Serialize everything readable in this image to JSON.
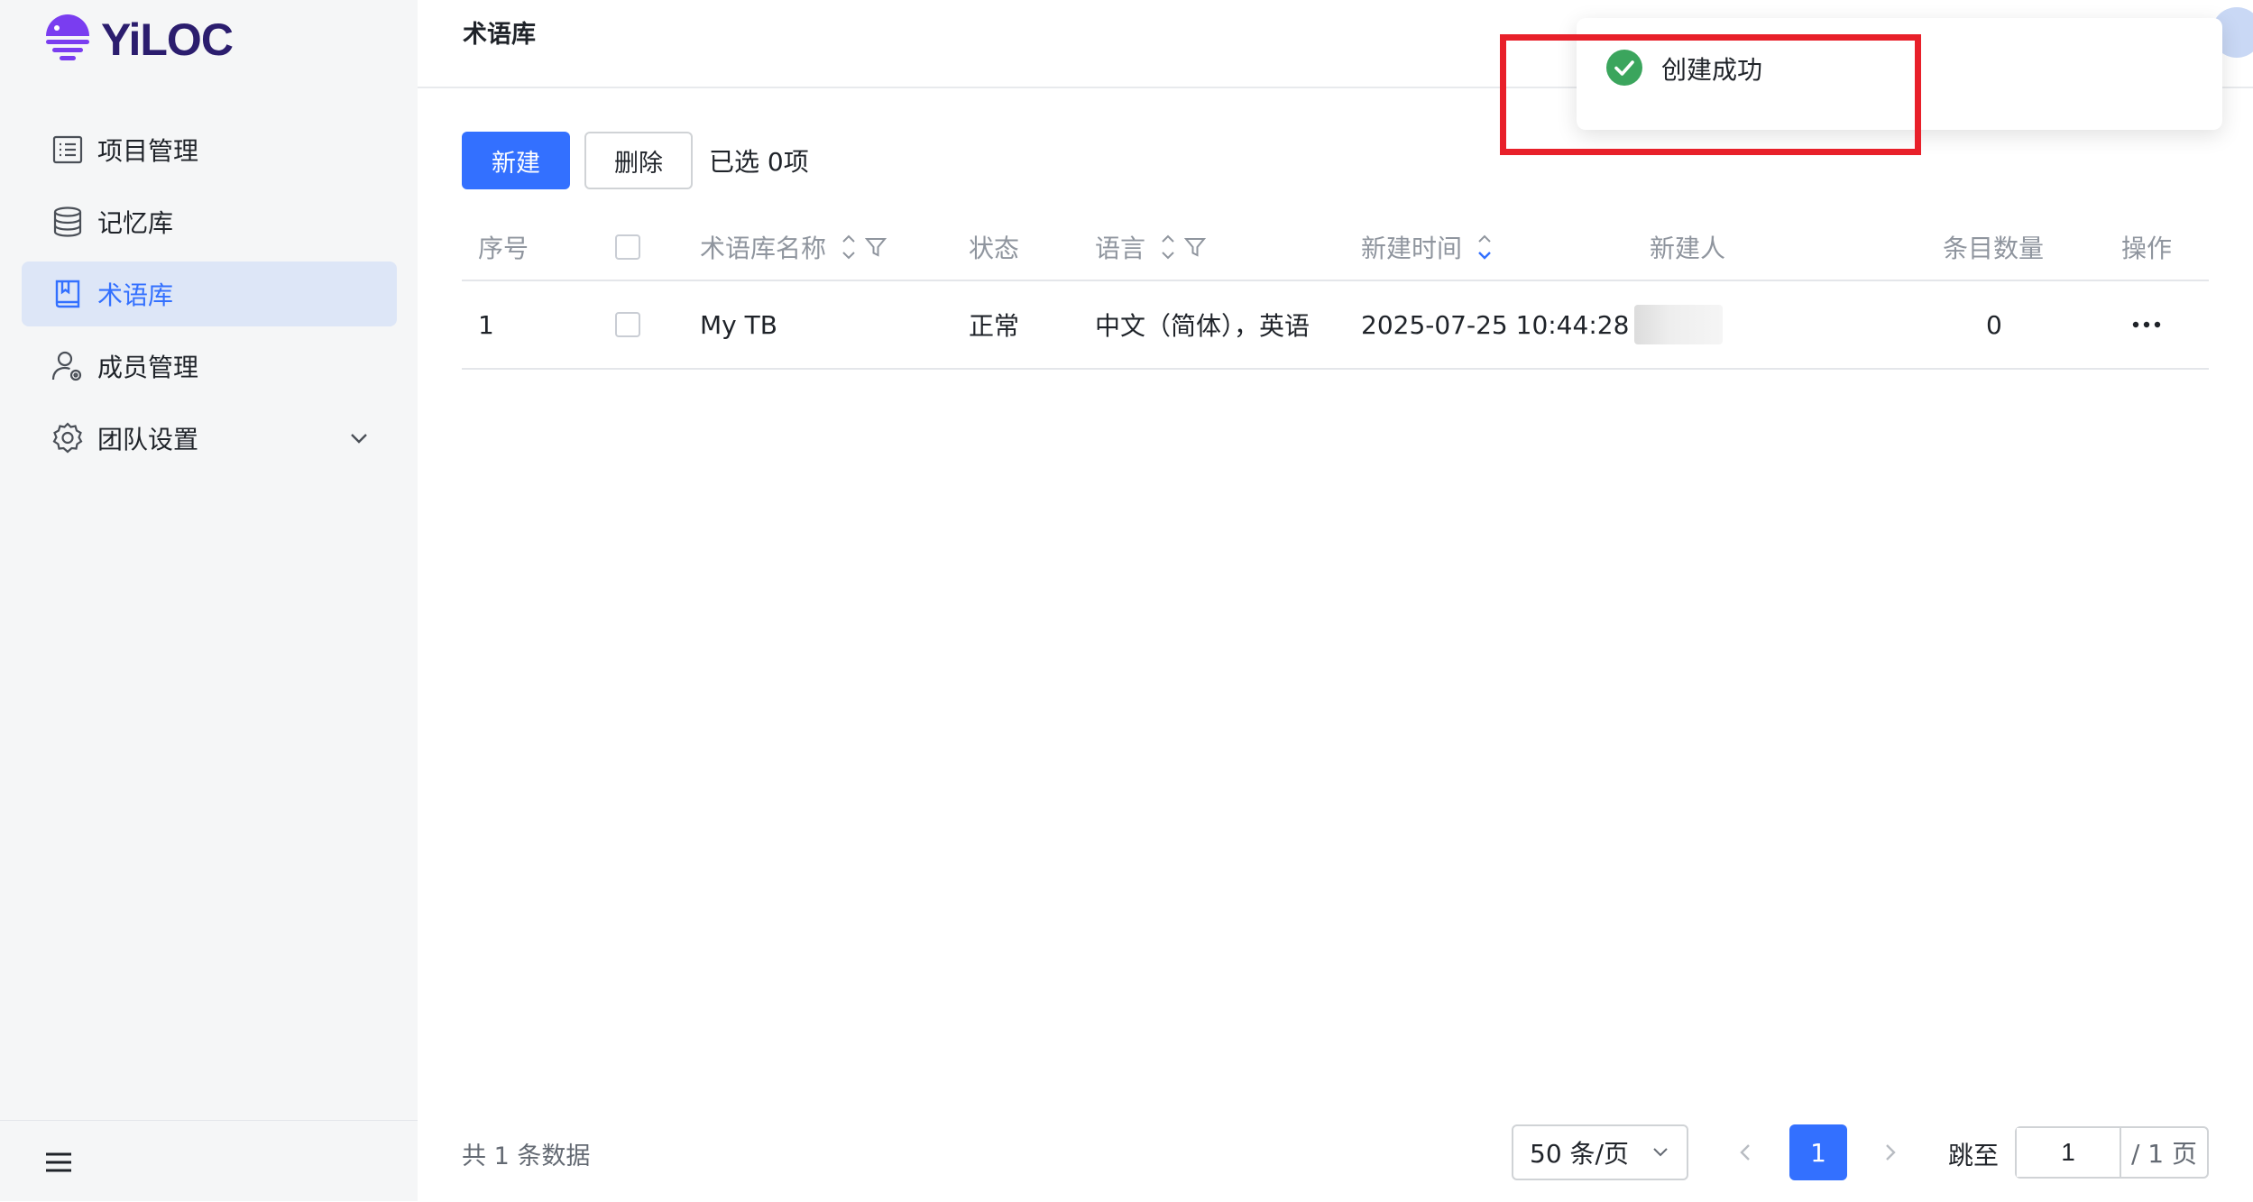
{
  "app": {
    "logo_text": "YiLOC",
    "brand_color": "#7a3df0",
    "accent_color": "#3370ff"
  },
  "sidebar": {
    "items": [
      {
        "label": "项目管理",
        "icon": "list-icon"
      },
      {
        "label": "记忆库",
        "icon": "database-icon"
      },
      {
        "label": "术语库",
        "icon": "book-icon",
        "active": true
      },
      {
        "label": "成员管理",
        "icon": "user-settings-icon"
      },
      {
        "label": "团队设置",
        "icon": "gear-icon",
        "expandable": true
      }
    ]
  },
  "header": {
    "title": "术语库"
  },
  "toolbar": {
    "new_label": "新建",
    "delete_label": "删除",
    "selected_text": "已选 0项"
  },
  "table": {
    "columns": [
      "序号",
      "",
      "术语库名称",
      "状态",
      "语言",
      "新建时间",
      "新建人",
      "条目数量",
      "操作"
    ],
    "rows": [
      {
        "index": "1",
        "name": "My TB",
        "status": "正常",
        "languages": "中文（简体），英语",
        "created_at": "2025-07-25 10:44:28",
        "entries": "0"
      }
    ]
  },
  "footer": {
    "total_text": "共 1 条数据",
    "page_size": "50 条/页",
    "current_page": "1",
    "jump_label": "跳至",
    "jump_value": "1",
    "total_pages": "/ 1 页"
  },
  "toast": {
    "message": "创建成功",
    "type": "success",
    "color": "#3ba55d"
  }
}
